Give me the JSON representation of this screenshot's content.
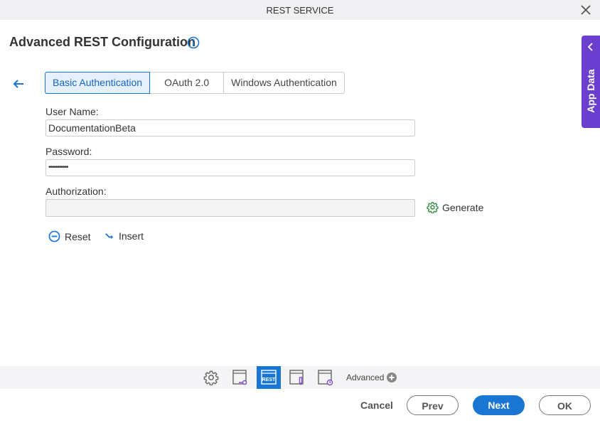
{
  "window": {
    "title": "REST SERVICE"
  },
  "page": {
    "heading": "Advanced REST Configuration"
  },
  "tabs": [
    {
      "label": "Basic Authentication",
      "active": true
    },
    {
      "label": "OAuth 2.0",
      "active": false
    },
    {
      "label": "Windows Authentication",
      "active": false
    }
  ],
  "form": {
    "username_label": "User Name:",
    "username_value": "DocumentationBeta",
    "password_label": "Password:",
    "password_value": "•••••••••••",
    "authorization_label": "Authorization:",
    "authorization_value": "",
    "generate_label": "Generate",
    "reset_label": "Reset",
    "insert_label": "Insert"
  },
  "side_panel": {
    "label": "App Data"
  },
  "toolbar": {
    "icons": [
      "gear-icon",
      "window-key-icon",
      "rest-icon",
      "window-edit-icon",
      "window-clock-icon"
    ],
    "active_icon": "rest-icon",
    "rest_text": "REST",
    "advanced_label": "Advanced"
  },
  "footer": {
    "cancel": "Cancel",
    "prev": "Prev",
    "next": "Next",
    "ok": "OK"
  },
  "colors": {
    "accent": "#1976d2",
    "side_panel": "#6a3fd0",
    "generate_icon": "#2e8b3a"
  }
}
